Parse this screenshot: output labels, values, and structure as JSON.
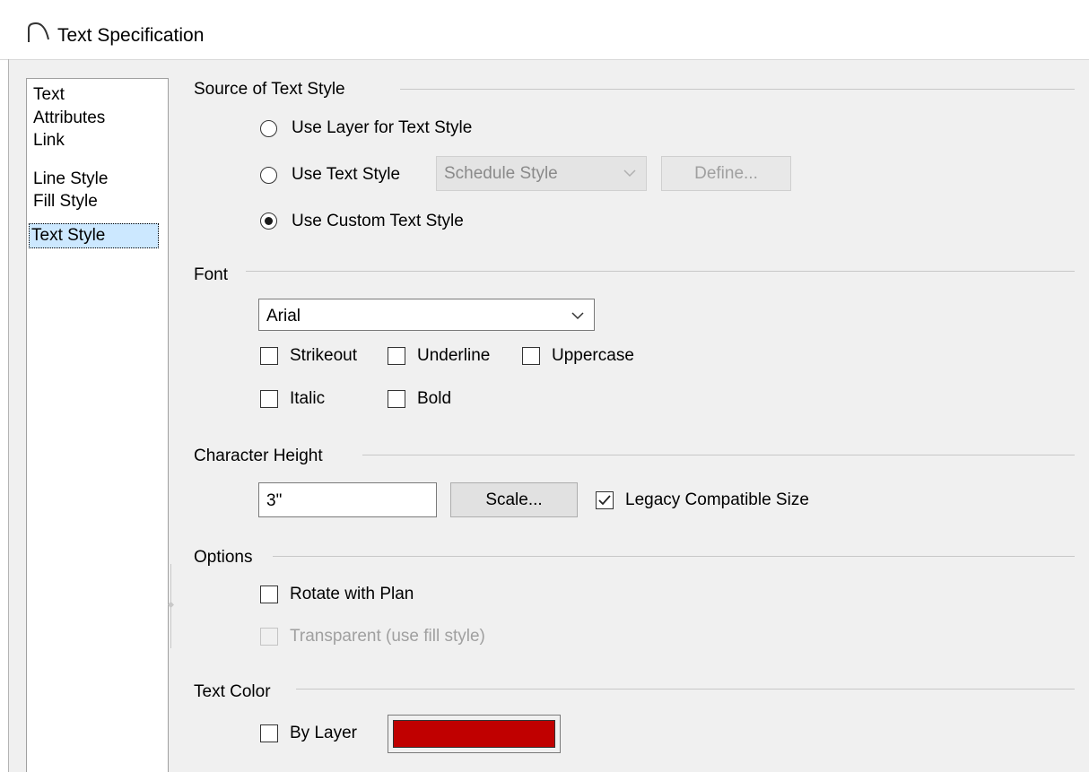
{
  "window": {
    "title": "Text Specification",
    "icon": "arch-curve-icon"
  },
  "nav": {
    "items": [
      {
        "label": "Text"
      },
      {
        "label": "Attributes"
      },
      {
        "label": "Link"
      },
      {
        "label": "Line Style"
      },
      {
        "label": "Fill Style"
      },
      {
        "label": "Text Style",
        "selected": true
      }
    ]
  },
  "source_group": {
    "label": "Source of Text Style",
    "use_layer_label": "Use Layer for Text Style",
    "use_text_style_label": "Use Text Style",
    "use_custom_label": "Use Custom Text Style",
    "selected": "use_custom",
    "style_combo_value": "Schedule Style",
    "define_label": "Define..."
  },
  "font_group": {
    "label": "Font",
    "font_value": "Arial",
    "strikeout_label": "Strikeout",
    "underline_label": "Underline",
    "uppercase_label": "Uppercase",
    "italic_label": "Italic",
    "bold_label": "Bold"
  },
  "height_group": {
    "label": "Character Height",
    "height_value": "3\"",
    "scale_label": "Scale...",
    "legacy_label": "Legacy Compatible Size",
    "legacy_checked": true
  },
  "options_group": {
    "label": "Options",
    "rotate_label": "Rotate with Plan",
    "transparent_label": "Transparent (use fill style)"
  },
  "color_group": {
    "label": "Text Color",
    "by_layer_label": "By Layer",
    "color": "#c00000"
  }
}
